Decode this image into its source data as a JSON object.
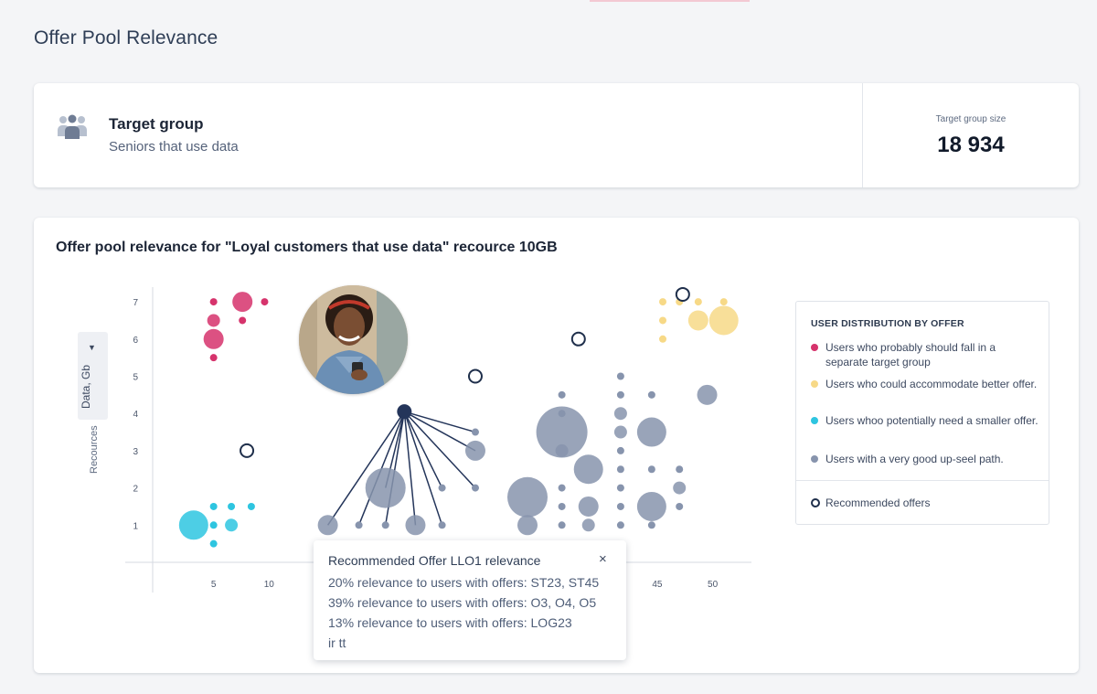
{
  "page": {
    "title": "Offer Pool Relevance"
  },
  "target_group": {
    "title": "Target group",
    "subtitle": "Seniors that use data",
    "size_label": "Target group size",
    "size_value": "18 934",
    "icon": "users-group-icon"
  },
  "chart_card": {
    "title": "Offer pool relevance for \"Loyal customers that use data\" recource 10GB",
    "y_selector_label": "Data, Gb",
    "y_axis_label": "Recources"
  },
  "legend": {
    "title": "USER DISTRIBUTION BY OFFER",
    "items": [
      {
        "label": "Users who probably should fall in a separate target group",
        "color": "#d6336c"
      },
      {
        "label": "Users who could accommodate better offer.",
        "color": "#f7d987"
      },
      {
        "label": "Users whoo potentially need a smaller offer.",
        "color": "#2ec5e0"
      },
      {
        "label": "Users with a very good up-seel path.",
        "color": "#8794ad"
      }
    ],
    "recommended_label": "Recommended offers"
  },
  "popover": {
    "title": "Recommended Offer LLO1 relevance",
    "close_label": "×",
    "lines": [
      "20% relevance to users with offers: ST23, ST45",
      "39% relevance to users with offers:  O3, O4, O5",
      "13% relevance to users with offers:  LOG23",
      "ir tt"
    ]
  },
  "chart_data": {
    "type": "scatter",
    "title": "Offer pool relevance for \"Loyal customers that use data\" recource 10GB",
    "ylabel": "Recources",
    "y_selector": "Data, Gb",
    "x_ticks_visible": [
      "5",
      "10",
      "1",
      "45",
      "50"
    ],
    "y_ticks": [
      "1",
      "2",
      "3",
      "4",
      "5",
      "6",
      "7"
    ],
    "ylim": [
      0,
      7.5
    ],
    "series": [
      {
        "name": "Users who probably should fall in a separate target group",
        "color": "#d6336c",
        "points": [
          [
            5,
            7,
            1
          ],
          [
            5,
            6.5,
            2
          ],
          [
            5,
            6,
            3
          ],
          [
            5,
            5.5,
            1
          ],
          [
            7.6,
            7,
            3
          ],
          [
            7.6,
            6.5,
            1
          ],
          [
            9.6,
            7,
            1
          ]
        ]
      },
      {
        "name": "Users who could accommodate better offer.",
        "color": "#f7d987",
        "points": [
          [
            45.5,
            7,
            1
          ],
          [
            47,
            7,
            1
          ],
          [
            48.7,
            7,
            1
          ],
          [
            51,
            7,
            1
          ],
          [
            45.5,
            6.5,
            1
          ],
          [
            45.5,
            6,
            1
          ],
          [
            48.7,
            6.5,
            3
          ],
          [
            51,
            6.5,
            4
          ]
        ]
      },
      {
        "name": "Users whoo potentially need a smaller offer.",
        "color": "#2ec5e0",
        "points": [
          [
            3.2,
            1,
            4
          ],
          [
            5,
            1,
            1
          ],
          [
            5,
            1.5,
            1
          ],
          [
            5,
            0.5,
            1
          ],
          [
            6.6,
            1.5,
            1
          ],
          [
            6.6,
            1,
            2
          ],
          [
            8.4,
            1.5,
            1
          ]
        ]
      },
      {
        "name": "Users with a very good up-seel path.",
        "color": "#8794ad",
        "points": [
          [
            15.3,
            1,
            3
          ],
          [
            18.1,
            1,
            1
          ],
          [
            20.5,
            1,
            1
          ],
          [
            20.5,
            2,
            5
          ],
          [
            23.2,
            1,
            3
          ],
          [
            25.6,
            1,
            1
          ],
          [
            25.6,
            2,
            1
          ],
          [
            28.6,
            2,
            1
          ],
          [
            28.6,
            3,
            3
          ],
          [
            28.6,
            3.5,
            1
          ],
          [
            33.3,
            1.75,
            5
          ],
          [
            33.3,
            1,
            3
          ],
          [
            36.4,
            3.5,
            6
          ],
          [
            36.4,
            3,
            2
          ],
          [
            36.4,
            4,
            1
          ],
          [
            36.4,
            4.5,
            1
          ],
          [
            36.4,
            2,
            1
          ],
          [
            36.4,
            1.5,
            1
          ],
          [
            36.4,
            1,
            1
          ],
          [
            38.8,
            2.5,
            4
          ],
          [
            38.8,
            1.5,
            3
          ],
          [
            38.8,
            1,
            2
          ],
          [
            41.7,
            4,
            2
          ],
          [
            41.7,
            3.5,
            2
          ],
          [
            41.7,
            3,
            1
          ],
          [
            41.7,
            2.5,
            1
          ],
          [
            41.7,
            2,
            1
          ],
          [
            41.7,
            1.5,
            1
          ],
          [
            41.7,
            1,
            1
          ],
          [
            41.7,
            5,
            1
          ],
          [
            41.7,
            4.5,
            1
          ],
          [
            44.5,
            4.5,
            1
          ],
          [
            44.5,
            3.5,
            4
          ],
          [
            44.5,
            2.5,
            1
          ],
          [
            44.5,
            1.5,
            4
          ],
          [
            44.5,
            1,
            1
          ],
          [
            47,
            2,
            2
          ],
          [
            47,
            2.5,
            1
          ],
          [
            47,
            1.5,
            1
          ],
          [
            49.5,
            4.5,
            3
          ]
        ]
      },
      {
        "name": "Recommended offers",
        "color": "#1f2f4b",
        "points": [
          [
            8,
            3
          ],
          [
            28.6,
            5
          ],
          [
            37.9,
            6
          ],
          [
            47.3,
            7.2
          ]
        ]
      }
    ],
    "selected_offer": {
      "x": 22.2,
      "y": 4.05
    }
  }
}
